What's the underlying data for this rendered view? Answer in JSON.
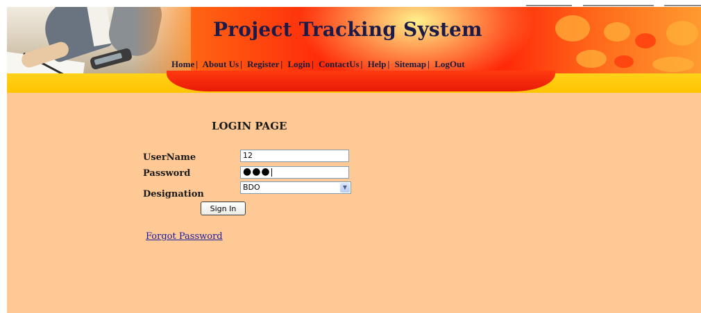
{
  "header": {
    "title": "Project Tracking System",
    "nav": [
      {
        "label": "Home"
      },
      {
        "label": "About Us"
      },
      {
        "label": "Register"
      },
      {
        "label": "Login"
      },
      {
        "label": "ContactUs"
      },
      {
        "label": "Help"
      },
      {
        "label": "Sitemap"
      },
      {
        "label": "LogOut"
      }
    ],
    "separator": "|"
  },
  "login": {
    "heading": "LOGIN PAGE",
    "username_label": "UserName",
    "username_value": "12",
    "password_label": "Password",
    "password_mask": "●●●",
    "designation_label": "Designation",
    "designation_value": "BDO",
    "sign_in_label": "Sign In",
    "forgot_label": "Forgot Password"
  },
  "colors": {
    "page_background": "#ffc996",
    "title_color": "#1b1b4a",
    "link_color": "#1a1aa0",
    "banner_red": "#ff2a0a",
    "band_yellow": "#ffc400"
  },
  "icons": {
    "dropdown": "chevron-down-icon"
  }
}
